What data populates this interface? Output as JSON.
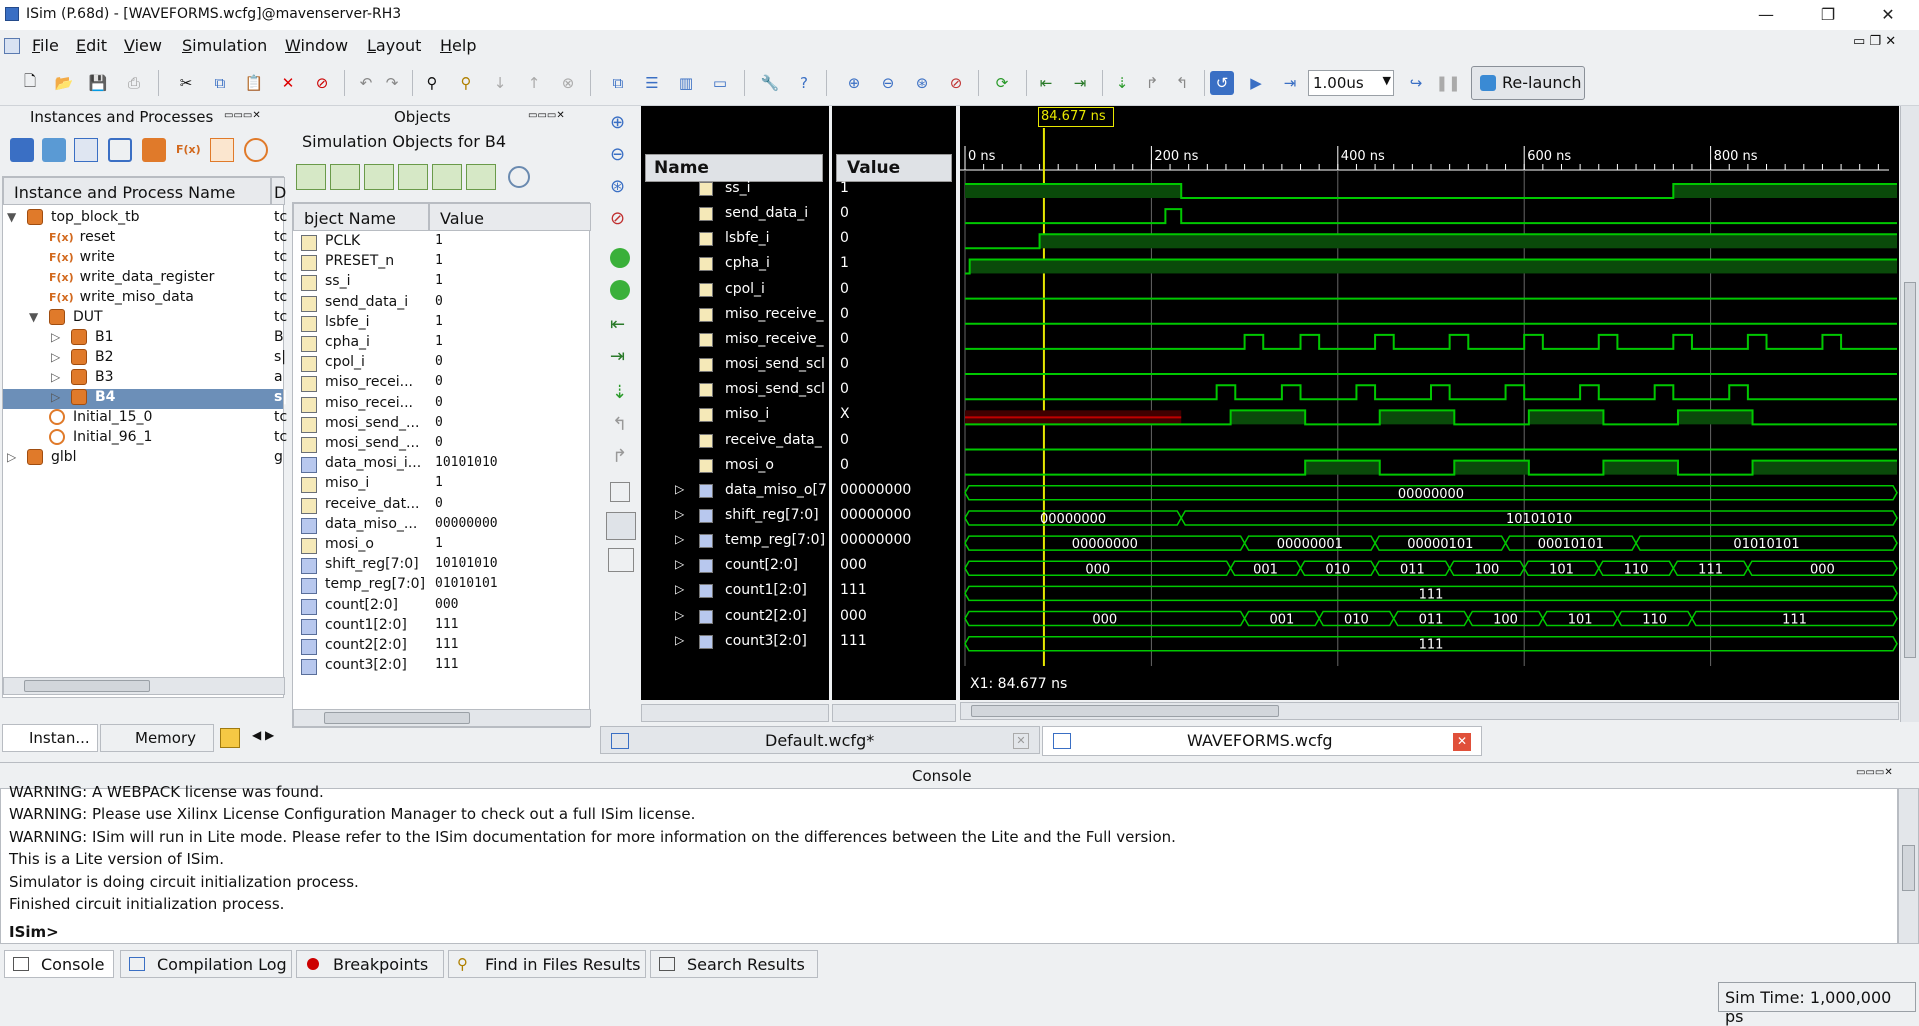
{
  "window": {
    "title": "ISim (P.68d) - [WAVEFORMS.wcfg]@mavenserver-RH3",
    "minimize": "—",
    "restore": "❐",
    "close": "✕"
  },
  "menu": [
    "File",
    "Edit",
    "View",
    "Simulation",
    "Window",
    "Layout",
    "Help"
  ],
  "toolbar": {
    "run_time": "1.00us",
    "relaunch_label": "Re-launch"
  },
  "instances_panel": {
    "title": "Instances and Processes",
    "col_name": "Instance and Process Name",
    "col_design": "D",
    "rows": [
      {
        "label": "top_block_tb",
        "d": "tc"
      },
      {
        "label": "reset",
        "d": "tc"
      },
      {
        "label": "write",
        "d": "tc"
      },
      {
        "label": "write_data_register",
        "d": "tc"
      },
      {
        "label": "write_miso_data",
        "d": "tc"
      },
      {
        "label": "DUT",
        "d": "tc"
      },
      {
        "label": "B1",
        "d": "B"
      },
      {
        "label": "B2",
        "d": "s|"
      },
      {
        "label": "B3",
        "d": "a"
      },
      {
        "label": "B4",
        "d": "s|"
      },
      {
        "label": "Initial_15_0",
        "d": "tc"
      },
      {
        "label": "Initial_96_1",
        "d": "tc"
      },
      {
        "label": "glbl",
        "d": "g"
      }
    ],
    "tabs": [
      "Instan...",
      "Memory"
    ]
  },
  "objects_panel": {
    "title": "Objects",
    "subtitle": "Simulation Objects for B4",
    "col_name": "bject Name",
    "col_value": "Value",
    "rows": [
      {
        "name": "PCLK",
        "value": "1"
      },
      {
        "name": "PRESET_n",
        "value": "1"
      },
      {
        "name": "ss_i",
        "value": "1"
      },
      {
        "name": "send_data_i",
        "value": "0"
      },
      {
        "name": "lsbfe_i",
        "value": "1"
      },
      {
        "name": "cpha_i",
        "value": "1"
      },
      {
        "name": "cpol_i",
        "value": "0"
      },
      {
        "name": "miso_recei...",
        "value": "0"
      },
      {
        "name": "miso_recei...",
        "value": "0"
      },
      {
        "name": "mosi_send_...",
        "value": "0"
      },
      {
        "name": "mosi_send_...",
        "value": "0"
      },
      {
        "name": "data_mosi_i...",
        "value": "10101010"
      },
      {
        "name": "miso_i",
        "value": "1"
      },
      {
        "name": "receive_dat...",
        "value": "0"
      },
      {
        "name": "data_miso_...",
        "value": "00000000"
      },
      {
        "name": "mosi_o",
        "value": "1"
      },
      {
        "name": "shift_reg[7:0]",
        "value": "10101010"
      },
      {
        "name": "temp_reg[7:0]",
        "value": "01010101"
      },
      {
        "name": "count[2:0]",
        "value": "000"
      },
      {
        "name": "count1[2:0]",
        "value": "111"
      },
      {
        "name": "count2[2:0]",
        "value": "111"
      },
      {
        "name": "count3[2:0]",
        "value": "111"
      }
    ]
  },
  "wave": {
    "name_header": "Name",
    "value_header": "Value",
    "cursor_label": "84.677 ns",
    "cursor_readout": "X1: 84.677 ns",
    "time_ticks": [
      "0 ns",
      "200 ns",
      "400 ns",
      "600 ns",
      "800 ns"
    ],
    "signals": [
      {
        "name": "ss_i",
        "value": "1",
        "bus": false
      },
      {
        "name": "send_data_i",
        "value": "0",
        "bus": false
      },
      {
        "name": "lsbfe_i",
        "value": "0",
        "bus": false
      },
      {
        "name": "cpha_i",
        "value": "1",
        "bus": false
      },
      {
        "name": "cpol_i",
        "value": "0",
        "bus": false
      },
      {
        "name": "miso_receive_",
        "value": "0",
        "bus": false
      },
      {
        "name": "miso_receive_",
        "value": "0",
        "bus": false
      },
      {
        "name": "mosi_send_scl",
        "value": "0",
        "bus": false
      },
      {
        "name": "mosi_send_scl",
        "value": "0",
        "bus": false
      },
      {
        "name": "miso_i",
        "value": "X",
        "bus": false
      },
      {
        "name": "receive_data_",
        "value": "0",
        "bus": false
      },
      {
        "name": "mosi_o",
        "value": "0",
        "bus": false
      },
      {
        "name": "data_miso_o[7",
        "value": "00000000",
        "bus": true
      },
      {
        "name": "shift_reg[7:0]",
        "value": "00000000",
        "bus": true
      },
      {
        "name": "temp_reg[7:0]",
        "value": "00000000",
        "bus": true
      },
      {
        "name": "count[2:0]",
        "value": "000",
        "bus": true
      },
      {
        "name": "count1[2:0]",
        "value": "111",
        "bus": true
      },
      {
        "name": "count2[2:0]",
        "value": "000",
        "bus": true
      },
      {
        "name": "count3[2:0]",
        "value": "111",
        "bus": true
      }
    ],
    "bus_labels": {
      "data_miso": [
        "00000000"
      ],
      "shift_reg": [
        "00000000",
        "10101010"
      ],
      "temp_reg": [
        "00000000",
        "00000001",
        "00000101",
        "00010101",
        "01010101"
      ],
      "count": [
        "000",
        "001",
        "010",
        "011",
        "100",
        "101",
        "110",
        "111",
        "000"
      ],
      "count1": [
        "111"
      ],
      "count2": [
        "000",
        "001",
        "010",
        "011",
        "100",
        "101",
        "110",
        "111"
      ],
      "count3": [
        "111"
      ]
    },
    "tabs": [
      "Default.wcfg*",
      "WAVEFORMS.wcfg"
    ]
  },
  "console": {
    "title": "Console",
    "lines": [
      "WARNING: A WEBPACK license was found.",
      "WARNING: Please use Xilinx License Configuration Manager to check out a full ISim license.",
      "WARNING: ISim will run in Lite mode. Please refer to the ISim documentation for more information on the differences between the Lite and the Full version.",
      "This is a Lite version of ISim.",
      "Simulator is doing circuit initialization process.",
      "Finished circuit initialization process."
    ],
    "prompt": "ISim>"
  },
  "bottom_tabs": [
    "Console",
    "Compilation Log",
    "Breakpoints",
    "Find in Files Results",
    "Search Results"
  ],
  "status": {
    "sim_time": "Sim Time: 1,000,000 ps"
  },
  "colors": {
    "wave_green": "#00c800",
    "wave_red": "#c00000",
    "cursor_yellow": "#e8e800",
    "selection": "#6c8fb8"
  }
}
